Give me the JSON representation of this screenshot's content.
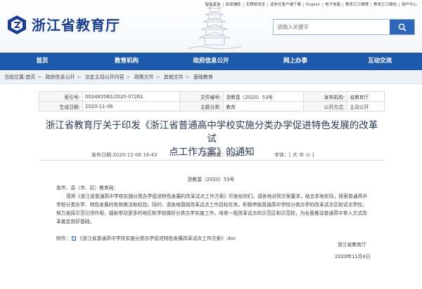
{
  "topbar": [
    "智能咨询",
    "阅读辅助",
    "无障碍浏览",
    "适老化客户端下载",
    "English",
    "电子信箱",
    "教育之江微博",
    "教育之江微信",
    "用户中心"
  ],
  "site": {
    "name": "浙江省教育厅"
  },
  "search": {
    "placeholder": "请输入关键字"
  },
  "nav": [
    "首页",
    "教育机构",
    "政府信息公开",
    "网上办事",
    "互动交流"
  ],
  "breadcrumb": [
    "当前位置:首页",
    "政府信息公开",
    "法定主动公开内容",
    "政策文件",
    "其他文件",
    "基础教育"
  ],
  "meta": {
    "index_label": "索引号:",
    "index_value": "002482082/2020-07261",
    "docnum_label": "文件编号:",
    "docnum_value": "浙教基〔2020〕53号",
    "org_label": "发布机构:",
    "org_value": "省教育厅",
    "date_label": "生成日期:",
    "date_value": "2020-11-06",
    "category_label": "主题分类:",
    "category_value": "教育",
    "mode_label": "公开方式:",
    "mode_value": "主动公开"
  },
  "article": {
    "title_line1": "浙江省教育厅关于印发《浙江省普通高中学校实施分类办学促进特色发展的改革试",
    "title_line2": "点工作方案》的通知",
    "publish_time": "发布日期:2020-11-06 16:43",
    "views": "浏览次数：5289",
    "font_size": "字体：[ 大 中 小 ]",
    "doc_number": "浙教基〔2020〕53号",
    "salutation": "各市、县（市、区）教育局：",
    "body": "现将《浙江省普通高中学校实施分类办学促进特色发展的改革试点工作方案》印发给你们。请各地对照方案要求，结合本地实际，探索普通高中学校分类办学、特色发展的有效做法和经验。同时，请各地围绕改革试点工作目标任务，积极申报普通高中学校分类办学的改革试点区和试点学校，努力发挥示范引领作用，辐射带动更多的地区和学校做好分类办学实施工作，培育一批改革试点的示范区和示范校，为全面推动普通高中育人方式改革奠定良好基础。",
    "attachment_label": "附件：",
    "attachment_name": "《浙江省普通高中学校实施分类办学促进特色发展改革试点工作方案》.doc",
    "signer": "浙江省教育厅",
    "sign_date": "2020年11月4日"
  },
  "colors": {
    "nav_bg": "#1e5aac",
    "brand": "#1b3f8e",
    "search_btn": "#2e67b9"
  }
}
